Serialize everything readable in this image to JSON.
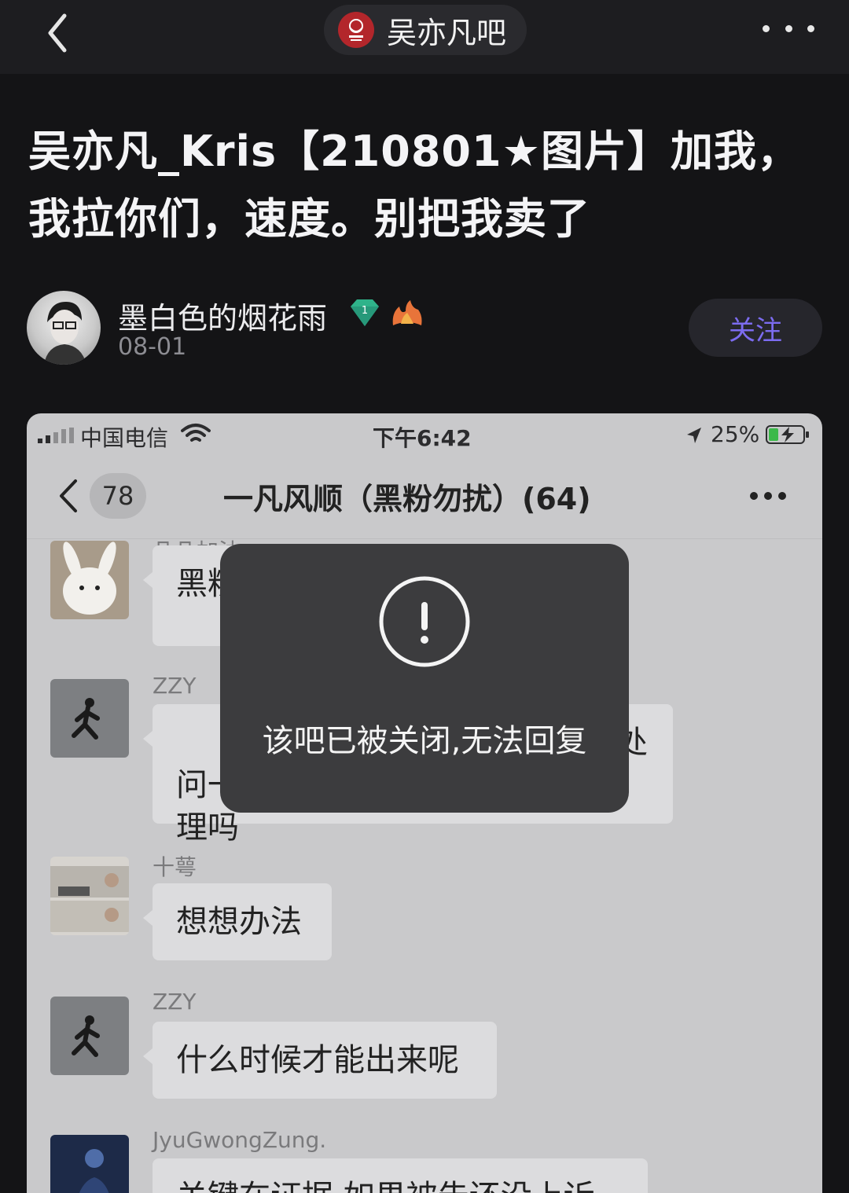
{
  "topbar": {
    "forum_name": "吴亦凡吧",
    "back_icon": "chevron-left-icon",
    "more_icon": "more-horizontal-icon"
  },
  "post": {
    "title": "吴亦凡_Kris【210801★图片】加我，我拉你们，速度。别把我卖了",
    "author": "墨白色的烟花雨",
    "level_badge": "1",
    "date": "08-01",
    "follow_label": "关注",
    "accent_color": "#7c6cf0"
  },
  "screenshot": {
    "status": {
      "carrier": "中国电信",
      "time": "下午6:42",
      "battery": "25%"
    },
    "chat": {
      "unread_count": "78",
      "group_name": "一凡风顺（黑粉勿扰）(64)",
      "messages": [
        {
          "sender": "凡凡加油",
          "text": "黑粉"
        },
        {
          "sender": "ZZY",
          "text": "问一\n理吗",
          "text_right": "处"
        },
        {
          "sender": "十萼",
          "text": "想想办法"
        },
        {
          "sender": "ZZY",
          "text": "什么时候才能出来呢"
        },
        {
          "sender": "JyuGwongZung.",
          "text": "关键在证据 如果被告还没上诉"
        }
      ]
    },
    "toast": {
      "text": "该吧已被关闭,无法回复",
      "icon": "exclamation-circle-icon"
    }
  }
}
